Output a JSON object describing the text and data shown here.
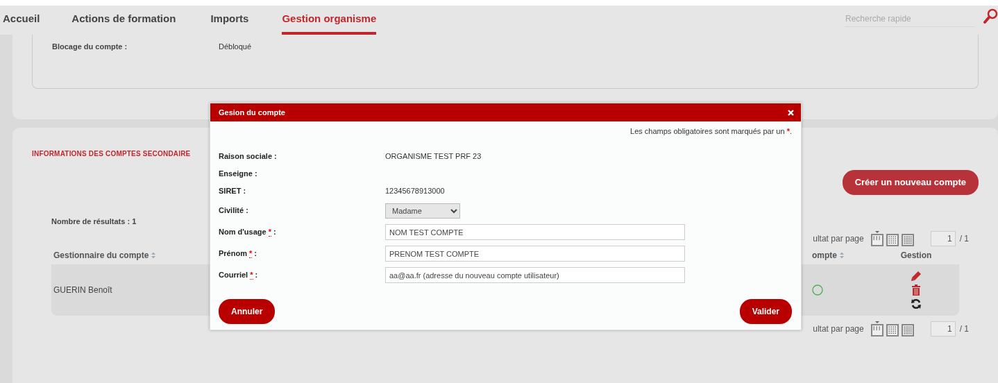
{
  "top_nav": {
    "tabs": [
      {
        "label": "Accueil",
        "selected": false
      },
      {
        "label": "Actions de formation",
        "selected": false
      },
      {
        "label": "Imports",
        "selected": false
      },
      {
        "label": "Gestion organisme",
        "selected": true
      }
    ],
    "search": {
      "placeholder": "Recherche rapide"
    }
  },
  "account_panel": {
    "fields": [
      {
        "label": "Blocage du compte :",
        "value": "Débloqué"
      }
    ]
  },
  "secondary_accounts": {
    "title": "INFORMATIONS DES COMPTES SECONDAIRE",
    "create_button": "Créer un nouveau compte",
    "result_count": "Nombre de résultats : 1",
    "pagination_top": {
      "label": "ultat par page",
      "page_sizes": [
        {
          "selected": true
        },
        {
          "selected": false
        },
        {
          "selected": false
        }
      ],
      "page": "1",
      "total": "/ 1"
    },
    "table": {
      "columns": [
        {
          "label": "Gestionnaire du compte",
          "sortable": true
        },
        {
          "label": "ompte",
          "sortable": true
        },
        {
          "label": "Gestion",
          "sortable": false
        }
      ],
      "rows": [
        {
          "manager": "GUERIN Benoît"
        }
      ]
    },
    "pagination_bottom": {
      "label": "ultat par page",
      "page_sizes": [
        {
          "selected": true
        },
        {
          "selected": false
        },
        {
          "selected": false
        }
      ],
      "page": "1",
      "total": "/ 1"
    }
  },
  "modal": {
    "title": "Gesion du compte",
    "required_note": {
      "text": "Les champs obligatoires sont marqués par un ",
      "mark": "*",
      "end": "."
    },
    "fields": [
      {
        "kind": "text",
        "label": "Raison sociale",
        "required": false,
        "value": "ORGANISME TEST PRF 23"
      },
      {
        "kind": "text",
        "label": "Enseigne",
        "required": false
      },
      {
        "kind": "text",
        "label": "SIRET",
        "required": false,
        "value": "12345678913000"
      },
      {
        "kind": "select",
        "label": "Civilité",
        "required": false,
        "value": "Madame"
      },
      {
        "kind": "input",
        "label": "Nom d'usage",
        "required": true,
        "value": "NOM TEST COMPTE"
      },
      {
        "kind": "input",
        "label": "Prénom",
        "required": true,
        "value": "PRENOM TEST COMPTE"
      },
      {
        "kind": "input",
        "label": "Courriel",
        "required": true,
        "value": "aa@aa.fr (adresse du nouveau compte utilisateur)"
      }
    ],
    "required_mark": "*",
    "label_separator": ":",
    "buttons": [
      {
        "label": "Annuler"
      },
      {
        "label": "Valider"
      }
    ]
  }
}
